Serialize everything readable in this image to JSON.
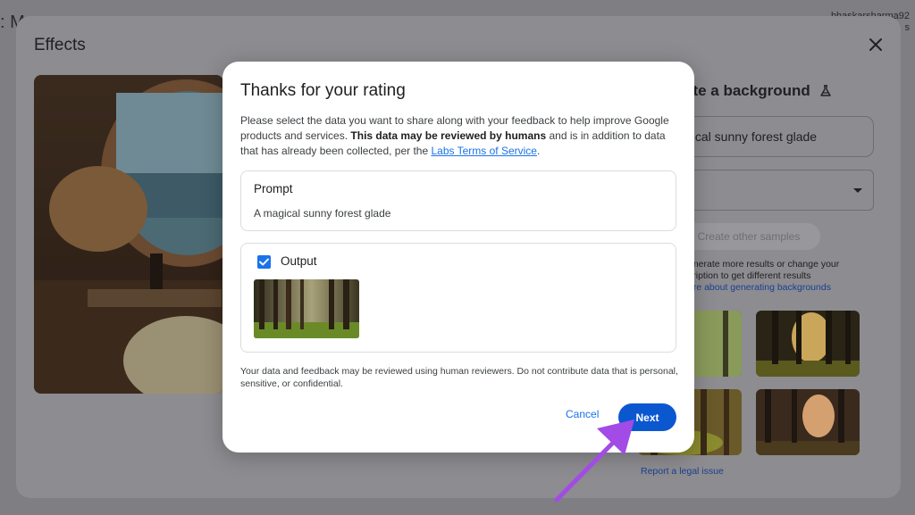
{
  "background_page": {
    "title_fragment": ": M",
    "user_fragment_1": "bhaskarsharma92",
    "user_fragment_2": "s"
  },
  "effects_panel": {
    "title": "Effects",
    "close_icon": "close-icon",
    "right_panel": {
      "heading": "ate a background",
      "heading_icon": "flask-icon",
      "prompt_value": "gical sunny forest glade",
      "select_caret_icon": "chevron-down-icon",
      "create_button_label": "Create other samples",
      "help_text_line_1": "enerate more results or change your",
      "help_text_line_2": "cription to get different results",
      "help_link": "ore about generating backgrounds",
      "legal_link": "Report a legal issue"
    }
  },
  "dialog": {
    "title": "Thanks for your rating",
    "description_part1": "Please select the data you want to share along with your feedback to help improve Google products and services. ",
    "description_bold": "This data may be reviewed by humans",
    "description_part2": " and is in addition to data that has already been collected, per the ",
    "description_link": "Labs Terms of Service",
    "description_end": ".",
    "prompt_card": {
      "label": "Prompt",
      "value": "A magical sunny forest glade"
    },
    "output_card": {
      "label": "Output",
      "checked": true
    },
    "disclaimer": "Your data and feedback may be reviewed using human reviewers. Do not contribute data that is personal, sensitive, or confidential.",
    "cancel_label": "Cancel",
    "next_label": "Next"
  },
  "colors": {
    "primary_blue": "#0b57d0",
    "link_blue": "#1a73e8",
    "annotation_arrow": "#a24be6"
  }
}
